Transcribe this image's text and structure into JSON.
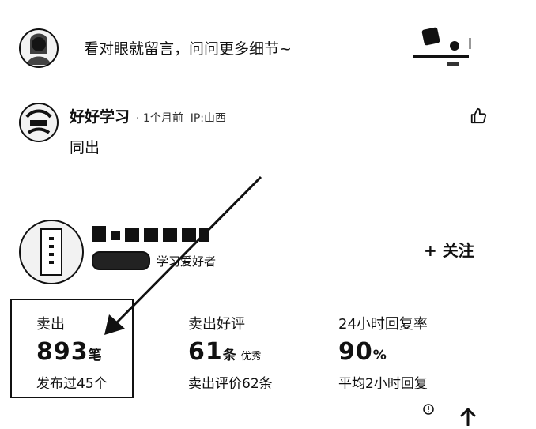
{
  "top_comment": {
    "text": "看对眼就留言，问问更多细节~"
  },
  "comment": {
    "username": "好好学习",
    "meta": "· 1个月前  IP:山西",
    "text": "同出"
  },
  "seller": {
    "badge": "学习爱好者",
    "follow_label": "+ 关注"
  },
  "stats": [
    {
      "label": "卖出",
      "value": "893",
      "unit": "笔",
      "tag": "",
      "sub": "发布过45个"
    },
    {
      "label": "卖出好评",
      "value": "61",
      "unit": "条",
      "tag": "优秀",
      "sub": "卖出评价62条"
    },
    {
      "label": "24小时回复率",
      "value": "90",
      "unit": "%",
      "tag": "",
      "sub": "平均2小时回复"
    }
  ],
  "icons": {
    "like": "thumbs-up-icon",
    "scroll_top": "arrow-up-icon",
    "report": "report-icon"
  },
  "colors": {
    "text": "#111111",
    "highlight_border": "#111111",
    "background": "#ffffff"
  }
}
